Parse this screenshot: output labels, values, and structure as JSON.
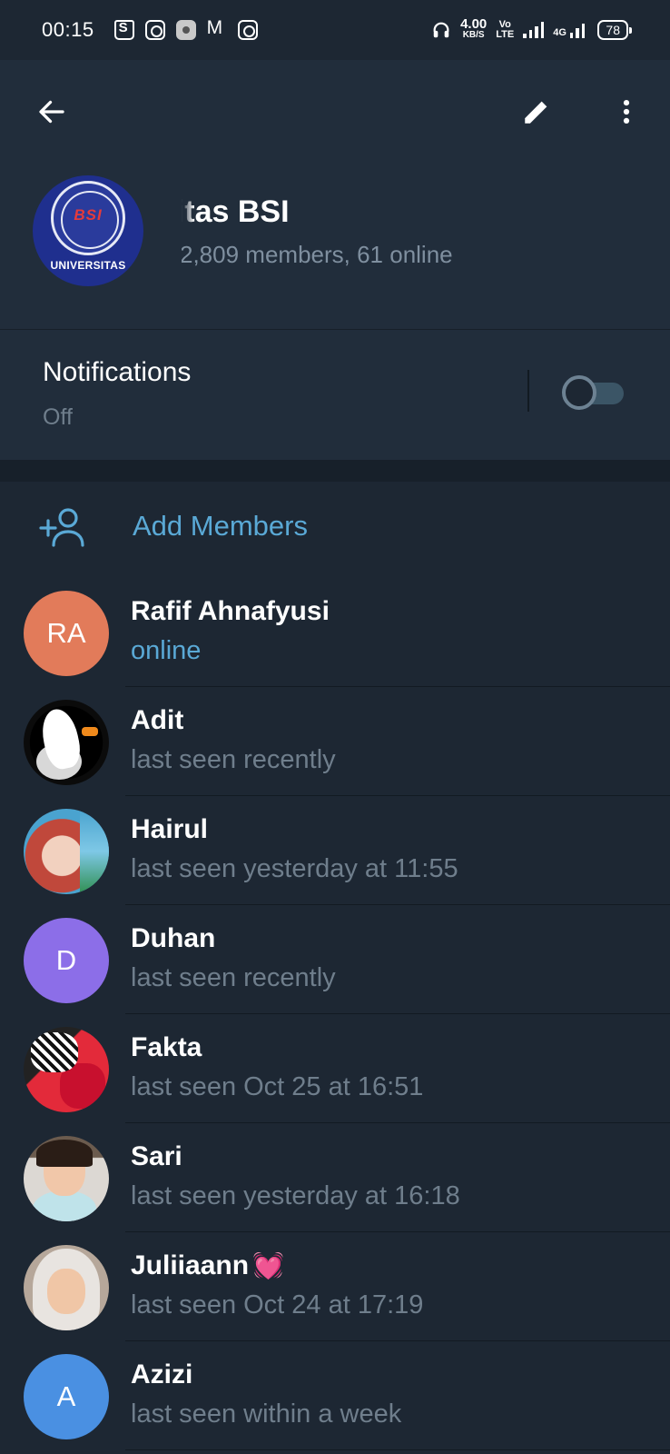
{
  "status_bar": {
    "time": "00:15",
    "net_speed_value": "4.00",
    "net_speed_unit": "KB/S",
    "volte_top": "Vo",
    "volte_bottom": "LTE",
    "network_type": "4G",
    "battery": "78"
  },
  "header": {
    "group_title": "Ikatan Alumni Universitas BSI",
    "group_subtitle": "2,809 members, 61 online",
    "avatar_text_top": "BSI",
    "avatar_text_bottom": "UNIVERSITAS"
  },
  "notifications": {
    "title": "Notifications",
    "state": "Off",
    "enabled": false
  },
  "add_members": {
    "label": "Add Members"
  },
  "members": [
    {
      "name": "Rafif Ahnafyusi",
      "status": "online",
      "initials": "RA",
      "avatar_color": "#e27b5a",
      "online": true
    },
    {
      "name": "Adit",
      "status": "last seen recently",
      "avatar_icon": "bugs-bunny-photo"
    },
    {
      "name": "Hairul",
      "status": "last seen yesterday at 11:55",
      "avatar_icon": "baby-photo"
    },
    {
      "name": "Duhan",
      "status": "last seen recently",
      "initials": "D",
      "avatar_color": "#8c6ee8"
    },
    {
      "name": "Fakta",
      "status": "last seen Oct 25 at 16:51",
      "avatar_icon": "red-artwork-photo"
    },
    {
      "name": "Sari",
      "status": "last seen yesterday at 16:18",
      "avatar_icon": "girl-selfie-photo"
    },
    {
      "name": "Juliiaann",
      "status": "last seen Oct 24 at 17:19",
      "avatar_icon": "hijab-selfie-photo",
      "name_emoji": "💓"
    },
    {
      "name": "Azizi",
      "status": "last seen within a week",
      "initials": "A",
      "avatar_color": "#4a90e2"
    }
  ],
  "colors": {
    "background": "#1d2733",
    "header_background": "#212d3b",
    "accent": "#5aa9d6",
    "secondary_text": "#6f7e8c"
  }
}
